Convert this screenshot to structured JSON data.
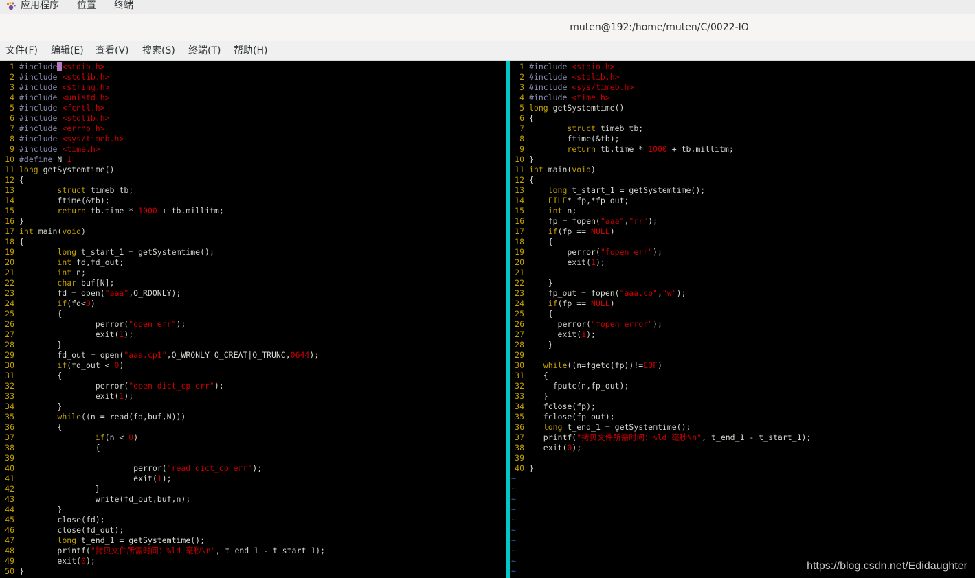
{
  "topbar": {
    "app_menu_icon": "gnome-foot-icon",
    "items": [
      "应用程序",
      "位置",
      "终端"
    ]
  },
  "window": {
    "title": "muten@192:/home/muten/C/0022-IO"
  },
  "menubar": {
    "items": [
      "文件(F)",
      "编辑(E)",
      "查看(V)",
      "搜索(S)",
      "终端(T)",
      "帮助(H)"
    ]
  },
  "colors": {
    "background": "#000000",
    "line_number": "#c4a000",
    "keyword": "#c4a000",
    "preprocessor": "#8a8ab0",
    "string": "#cc0000",
    "default_text": "#d3d7cf",
    "divider": "#00c8c8",
    "tilde": "#3465a4"
  },
  "left_pane": {
    "lines": [
      "#include <stdio.h>",
      "#include <stdlib.h>",
      "#include <string.h>",
      "#include <unistd.h>",
      "#include <fcntl.h>",
      "#include <stdlib.h>",
      "#include <errno.h>",
      "#include <sys/timeb.h>",
      "#include <time.h>",
      "#define N 1",
      "long getSystemtime()",
      "{",
      "        struct timeb tb;",
      "        ftime(&tb);",
      "        return tb.time * 1000 + tb.millitm;",
      "}",
      "int main(void)",
      "{",
      "        long t_start_1 = getSystemtime();",
      "        int fd,fd_out;",
      "        int n;",
      "        char buf[N];",
      "        fd = open(\"aaa\",O_RDONLY);",
      "        if(fd<0)",
      "        {",
      "                perror(\"open err\");",
      "                exit(1);",
      "        }",
      "        fd_out = open(\"aaa.cp1\",O_WRONLY|O_CREAT|O_TRUNC,0644);",
      "        if(fd_out < 0)",
      "        {",
      "                perror(\"open dict_cp err\");",
      "                exit(1);",
      "        }",
      "        while((n = read(fd,buf,N)))",
      "        {",
      "                if(n < 0)",
      "                {",
      "",
      "                        perror(\"read dict_cp err\");",
      "                        exit(1);",
      "                }",
      "                write(fd_out,buf,n);",
      "        }",
      "        close(fd);",
      "        close(fd_out);",
      "        long t_end_1 = getSystemtime();",
      "        printf(\"拷贝文件所需时间：%ld 毫秒\\n\", t_end_1 - t_start_1);",
      "        exit(0);",
      "}"
    ]
  },
  "right_pane": {
    "lines": [
      "#include <stdio.h>",
      "#include <stdlib.h>",
      "#include <sys/timeb.h>",
      "#include <time.h>",
      "long getSystemtime()",
      "{",
      "        struct timeb tb;",
      "        ftime(&tb);",
      "        return tb.time * 1000 + tb.millitm;",
      "}",
      "int main(void)",
      "{",
      "    long t_start_1 = getSystemtime();",
      "    FILE* fp,*fp_out;",
      "    int n;",
      "    fp = fopen(\"aaa\",\"rr\");",
      "    if(fp == NULL)",
      "    {",
      "        perror(\"fopen err\");",
      "        exit(1);",
      "",
      "    }",
      "    fp_out = fopen(\"aaa.cp\",\"w\");",
      "    if(fp == NULL)",
      "    {",
      "      perror(\"fopen error\");",
      "      exit(1);",
      "    }",
      "",
      "   while((n=fgetc(fp))!=EOF)",
      "   {",
      "     fputc(n,fp_out);",
      "   }",
      "   fclose(fp);",
      "   fclose(fp_out);",
      "   long t_end_1 = getSystemtime();",
      "   printf(\"拷贝文件所需时间：%ld 毫秒\\n\", t_end_1 - t_start_1);",
      "   exit(0);",
      "",
      "}"
    ],
    "tilde_count": 10
  },
  "watermark": "https://blog.csdn.net/Edidaughter"
}
